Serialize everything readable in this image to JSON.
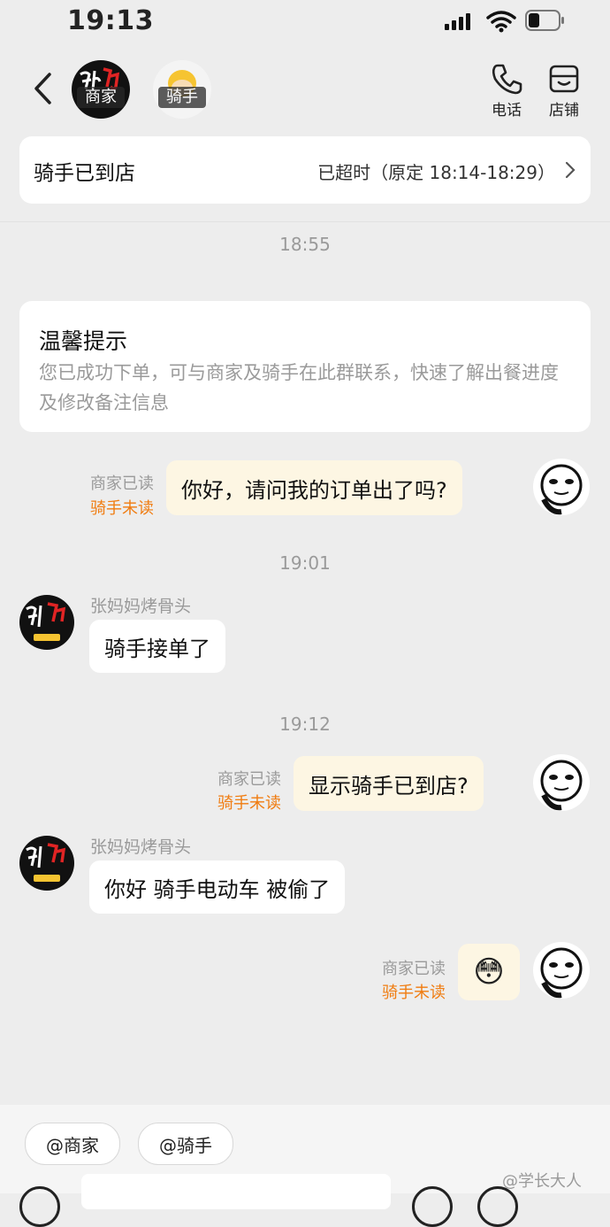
{
  "status_bar": {
    "time": "19:13"
  },
  "header": {
    "merchant_badge": "商家",
    "rider_badge": "骑手",
    "phone_label": "电话",
    "shop_label": "店铺"
  },
  "order_status": {
    "label": "骑手已到店",
    "detail": "已超时（原定 18:14-18:29）"
  },
  "messages": {
    "ts1": "18:55",
    "tip_title": "温馨提示",
    "tip_body": "您已成功下单，可与商家及骑手在此群联系，快速了解出餐进度及修改备注信息",
    "m1_text": "你好，请问我的订单出了吗?",
    "m1_read": "商家已读",
    "m1_unread": "骑手未读",
    "ts2": "19:01",
    "shop_name_1": "张妈妈烤骨头",
    "r1_text": "骑手接单了",
    "ts3": "19:12",
    "m2_text": "显示骑手已到店?",
    "m2_read": "商家已读",
    "m2_unread": "骑手未读",
    "shop_name_2": "张妈妈烤骨头",
    "r2_text": "你好 骑手电动车 被偷了",
    "m3_read": "商家已读",
    "m3_unread": "骑手未读",
    "m3_emoji": "😳"
  },
  "bottom": {
    "mention_merchant": "@商家",
    "mention_rider": "@骑手"
  },
  "watermark": "@学长大人",
  "colors": {
    "accent_orange": "#f07c10",
    "my_bubble": "#fdf6e3",
    "background": "#ededed"
  }
}
